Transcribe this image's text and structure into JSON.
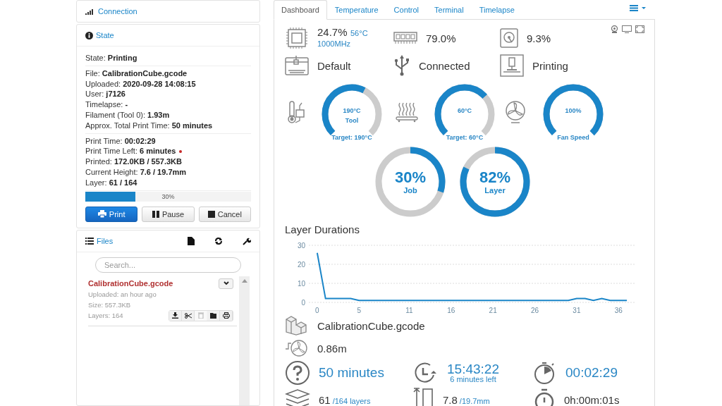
{
  "connection": {
    "title": "Connection"
  },
  "state": {
    "title": "State",
    "groups": [
      [
        {
          "text": "State: **Printing**",
          "indicator": false
        }
      ],
      [
        {
          "text": "File: **CalibrationCube.gcode**",
          "indicator": false
        },
        {
          "text": "Uploaded: **2020-09-28 14:08:15**",
          "indicator": false
        },
        {
          "text": "User: **j7126**",
          "indicator": false
        },
        {
          "text": "Timelapse: **-**",
          "indicator": false
        },
        {
          "text": "Filament (Tool 0): **1.93m**",
          "indicator": false
        },
        {
          "text": "Approx. Total Print Time: **50 minutes**",
          "indicator": false
        }
      ],
      [
        {
          "text": "Print Time: **00:02:29**",
          "indicator": false
        },
        {
          "text": "Print Time Left: **6 minutes**",
          "indicator": true
        },
        {
          "text": "Printed: **172.0KB / 557.3KB**",
          "indicator": false
        },
        {
          "text": "Current Height: **7.6 / 19.7mm**",
          "indicator": false
        },
        {
          "text": "Layer: **61 / 164**",
          "indicator": false
        }
      ]
    ],
    "progress": {
      "level": 0.3,
      "label": "30%"
    },
    "buttons": [
      {
        "label": "Print",
        "kind": "print"
      },
      {
        "label": "Pause",
        "kind": "pause"
      },
      {
        "label": "Cancel",
        "kind": "cancel"
      }
    ]
  },
  "files": {
    "title": "Files",
    "search": {
      "placeholder": "Search..."
    },
    "items": [
      {
        "name": "CalibrationCube.gcode",
        "uploaded": "Uploaded: an hour ago",
        "size": "Size: 557.3KB",
        "layers": "Layers: 164",
        "actions": [
          {
            "kind": "download",
            "disabled": false
          },
          {
            "kind": "slice",
            "disabled": false
          },
          {
            "kind": "delete",
            "disabled": true
          },
          {
            "kind": "load",
            "disabled": false
          },
          {
            "kind": "print",
            "disabled": false
          }
        ]
      }
    ]
  },
  "tabs": [
    {
      "label": "Dashboard",
      "selected": true
    },
    {
      "label": "Temperature",
      "selected": false
    },
    {
      "label": "Control",
      "selected": false
    },
    {
      "label": "Terminal",
      "selected": false
    },
    {
      "label": "Timelapse",
      "selected": false
    }
  ],
  "system": {
    "cpu": "24.7%",
    "cpu_temp": "56°C",
    "cpu_freq": "1000MHz",
    "ram": "79.0%",
    "disk": "9.3%"
  },
  "status": [
    {
      "kind": "profile",
      "text": "Default"
    },
    {
      "kind": "usb",
      "text": "Connected"
    },
    {
      "kind": "printer",
      "text": "Printing"
    }
  ],
  "gauges": [
    {
      "kind": "tool",
      "value": "190°C",
      "label": "Tool",
      "caption": "Target: 190°C"
    },
    {
      "kind": "bed",
      "value": "60°C",
      "caption": "Target: 60°C"
    },
    {
      "kind": "fan",
      "value": "100%",
      "caption": "Fan Speed"
    }
  ],
  "rings": [
    {
      "value": "30%",
      "label": "Job",
      "level": 0.3
    },
    {
      "value": "82%",
      "label": "Layer",
      "level": 0.82
    }
  ],
  "layer_durations": {
    "title": "Layer Durations",
    "chart_data": {
      "type": "line",
      "x": [
        0,
        1,
        2,
        3,
        4,
        5,
        6,
        7,
        8,
        9,
        10,
        11,
        12,
        13,
        14,
        15,
        16,
        17,
        18,
        19,
        20,
        21,
        22,
        23,
        24,
        25,
        26,
        27,
        28,
        29,
        30,
        31,
        32,
        33,
        34,
        35,
        36,
        37
      ],
      "series": [
        {
          "color": "#1a85c8",
          "values": [
            26,
            2,
            2,
            2,
            2,
            1,
            1,
            1,
            1,
            1,
            1,
            1,
            1,
            1,
            1,
            1,
            1,
            1,
            1,
            1,
            1,
            1,
            1,
            1,
            1,
            1,
            1,
            1,
            1,
            1,
            1,
            2,
            2,
            1,
            2,
            1,
            1,
            1
          ]
        }
      ],
      "xlim": [
        -1,
        38
      ],
      "ylim": [
        0,
        30
      ],
      "xticks": [
        0,
        5,
        11,
        16,
        21,
        26,
        31,
        36
      ],
      "yticks": [
        0,
        10,
        20,
        30
      ]
    }
  },
  "job": {
    "file": "CalibrationCube.gcode",
    "filament": "0.86m",
    "stats": [
      {
        "kind": "estimate",
        "value": "50 minutes",
        "highlight": true
      },
      {
        "kind": "eta",
        "value": "15:43:22",
        "sub": "6 minutes left",
        "highlight": true
      },
      {
        "kind": "elapsed",
        "value": "00:02:29",
        "highlight": true
      },
      {
        "kind": "layers",
        "value": "61",
        "sub": "/164 layers",
        "highlight": false
      },
      {
        "kind": "height",
        "value": "7.8",
        "sub": "/19.7mm",
        "highlight": false
      },
      {
        "kind": "layer_time",
        "value": "0h:00m:01s",
        "highlight": false
      }
    ]
  }
}
